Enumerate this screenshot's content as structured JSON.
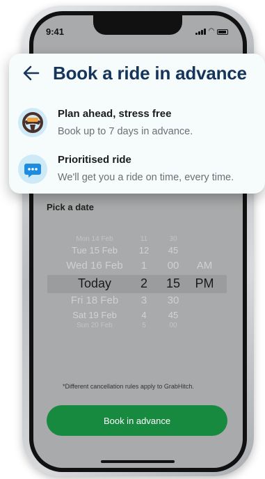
{
  "status_bar": {
    "time": "9:41",
    "icons": [
      "signal-icon",
      "wifi-icon",
      "battery-icon"
    ]
  },
  "popup": {
    "title": "Book a ride in advance",
    "back_icon": "arrow-left-icon",
    "features": [
      {
        "icon": "steering-wheel-icon",
        "title": "Plan ahead, stress free",
        "description": "Book up to 7 days in advance."
      },
      {
        "icon": "chat-bubble-icon",
        "title": "Prioritised ride",
        "description": "We'll get you a ride on time, every time."
      }
    ]
  },
  "picker": {
    "label": "Pick a date",
    "rows": [
      {
        "date": "Mon 14 Feb",
        "hour": "11",
        "minute": "30",
        "ampm": ""
      },
      {
        "date": "Tue 15 Feb",
        "hour": "12",
        "minute": "45",
        "ampm": ""
      },
      {
        "date": "Wed 16 Feb",
        "hour": "1",
        "minute": "00",
        "ampm": "AM"
      },
      {
        "date": "Today",
        "hour": "2",
        "minute": "15",
        "ampm": "PM"
      },
      {
        "date": "Fri 18 Feb",
        "hour": "3",
        "minute": "30",
        "ampm": ""
      },
      {
        "date": "Sat 19 Feb",
        "hour": "4",
        "minute": "45",
        "ampm": ""
      },
      {
        "date": "Sun 20 Feb",
        "hour": "5",
        "minute": "00",
        "ampm": ""
      }
    ]
  },
  "footer": {
    "note": "*Different cancellation rules apply to GrabHitch.",
    "button_label": "Book in advance"
  },
  "colors": {
    "title": "#16355a",
    "button": "#188a40",
    "icon_bg": "#cdeaf6",
    "overlay": "#a9aaab"
  }
}
